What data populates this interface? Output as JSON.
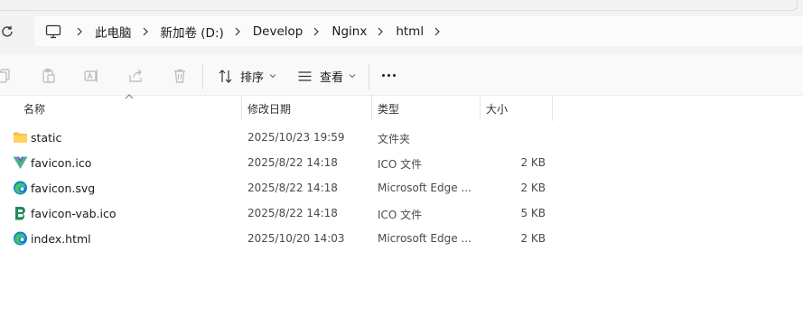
{
  "breadcrumbs": [
    "此电脑",
    "新加卷 (D:)",
    "Develop",
    "Nginx",
    "html"
  ],
  "toolbar": {
    "sort_label": "排序",
    "view_label": "查看"
  },
  "columns": {
    "name": "名称",
    "date": "修改日期",
    "type": "类型",
    "size": "大小"
  },
  "files": [
    {
      "name": "static",
      "date": "2025/10/23 19:59",
      "type": "文件夹",
      "size": "",
      "icon": "folder-icon"
    },
    {
      "name": "favicon.ico",
      "date": "2025/8/22 14:18",
      "type": "ICO 文件",
      "size": "2 KB",
      "icon": "vue-logo-icon"
    },
    {
      "name": "favicon.svg",
      "date": "2025/8/22 14:18",
      "type": "Microsoft Edge ...",
      "size": "2 KB",
      "icon": "edge-icon"
    },
    {
      "name": "favicon-vab.ico",
      "date": "2025/8/22 14:18",
      "type": "ICO 文件",
      "size": "5 KB",
      "icon": "vab-logo-icon"
    },
    {
      "name": "index.html",
      "date": "2025/10/20 14:03",
      "type": "Microsoft Edge ...",
      "size": "2 KB",
      "icon": "edge-icon"
    }
  ],
  "colors": {
    "folder": "#f6c344",
    "edge_blue": "#0f7bd6",
    "edge_green": "#3fc46d",
    "vab_green": "#1f8a5b"
  }
}
